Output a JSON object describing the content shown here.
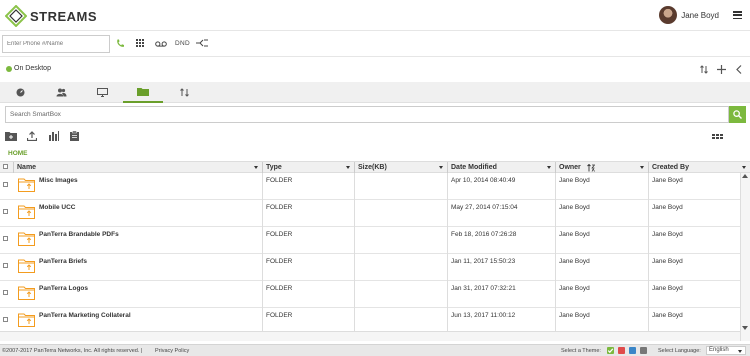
{
  "app": {
    "title": "STREAMS",
    "user_name": "Jane Boyd"
  },
  "phonebar": {
    "phone_placeholder": "Enter Phone #/Name",
    "dnd_label": "DND"
  },
  "status": {
    "text": "On Desktop",
    "color": "#7cb93e"
  },
  "search": {
    "placeholder": "Search SmartBox"
  },
  "breadcrumb": "HOME",
  "table": {
    "columns": [
      "Name",
      "Type",
      "Size(KB)",
      "Date Modified",
      "Owner",
      "Created By"
    ],
    "rows": [
      {
        "name": "Misc Images",
        "type": "FOLDER",
        "size": "",
        "date": "Apr 10, 2014 08:40:49",
        "owner": "Jane Boyd",
        "created_by": "Jane Boyd"
      },
      {
        "name": "Mobile UCC",
        "type": "FOLDER",
        "size": "",
        "date": "May 27, 2014 07:15:04",
        "owner": "Jane Boyd",
        "created_by": "Jane Boyd"
      },
      {
        "name": "PanTerra Brandable PDFs",
        "type": "FOLDER",
        "size": "",
        "date": "Feb 18, 2016 07:26:28",
        "owner": "Jane Boyd",
        "created_by": "Jane Boyd"
      },
      {
        "name": "PanTerra Briefs",
        "type": "FOLDER",
        "size": "",
        "date": "Jan 11, 2017 15:50:23",
        "owner": "Jane Boyd",
        "created_by": "Jane Boyd"
      },
      {
        "name": "PanTerra Logos",
        "type": "FOLDER",
        "size": "",
        "date": "Jan 31, 2017 07:32:21",
        "owner": "Jane Boyd",
        "created_by": "Jane Boyd"
      },
      {
        "name": "PanTerra Marketing Collateral",
        "type": "FOLDER",
        "size": "",
        "date": "Jun 13, 2017 11:00:12",
        "owner": "Jane Boyd",
        "created_by": "Jane Boyd"
      }
    ]
  },
  "footer": {
    "copyright": "©2007-2017 PanTerra Networks, Inc. All rights reserved.  |",
    "privacy": "Privacy Policy",
    "theme_label": "Select a Theme:",
    "theme_colors": [
      "#7cb93e",
      "#e04b4b",
      "#3a86c8",
      "#777777"
    ],
    "language_label": "Select Language:",
    "language": "English"
  },
  "colors": {
    "accent": "#7cb93e",
    "folder": "#f39c1f"
  }
}
